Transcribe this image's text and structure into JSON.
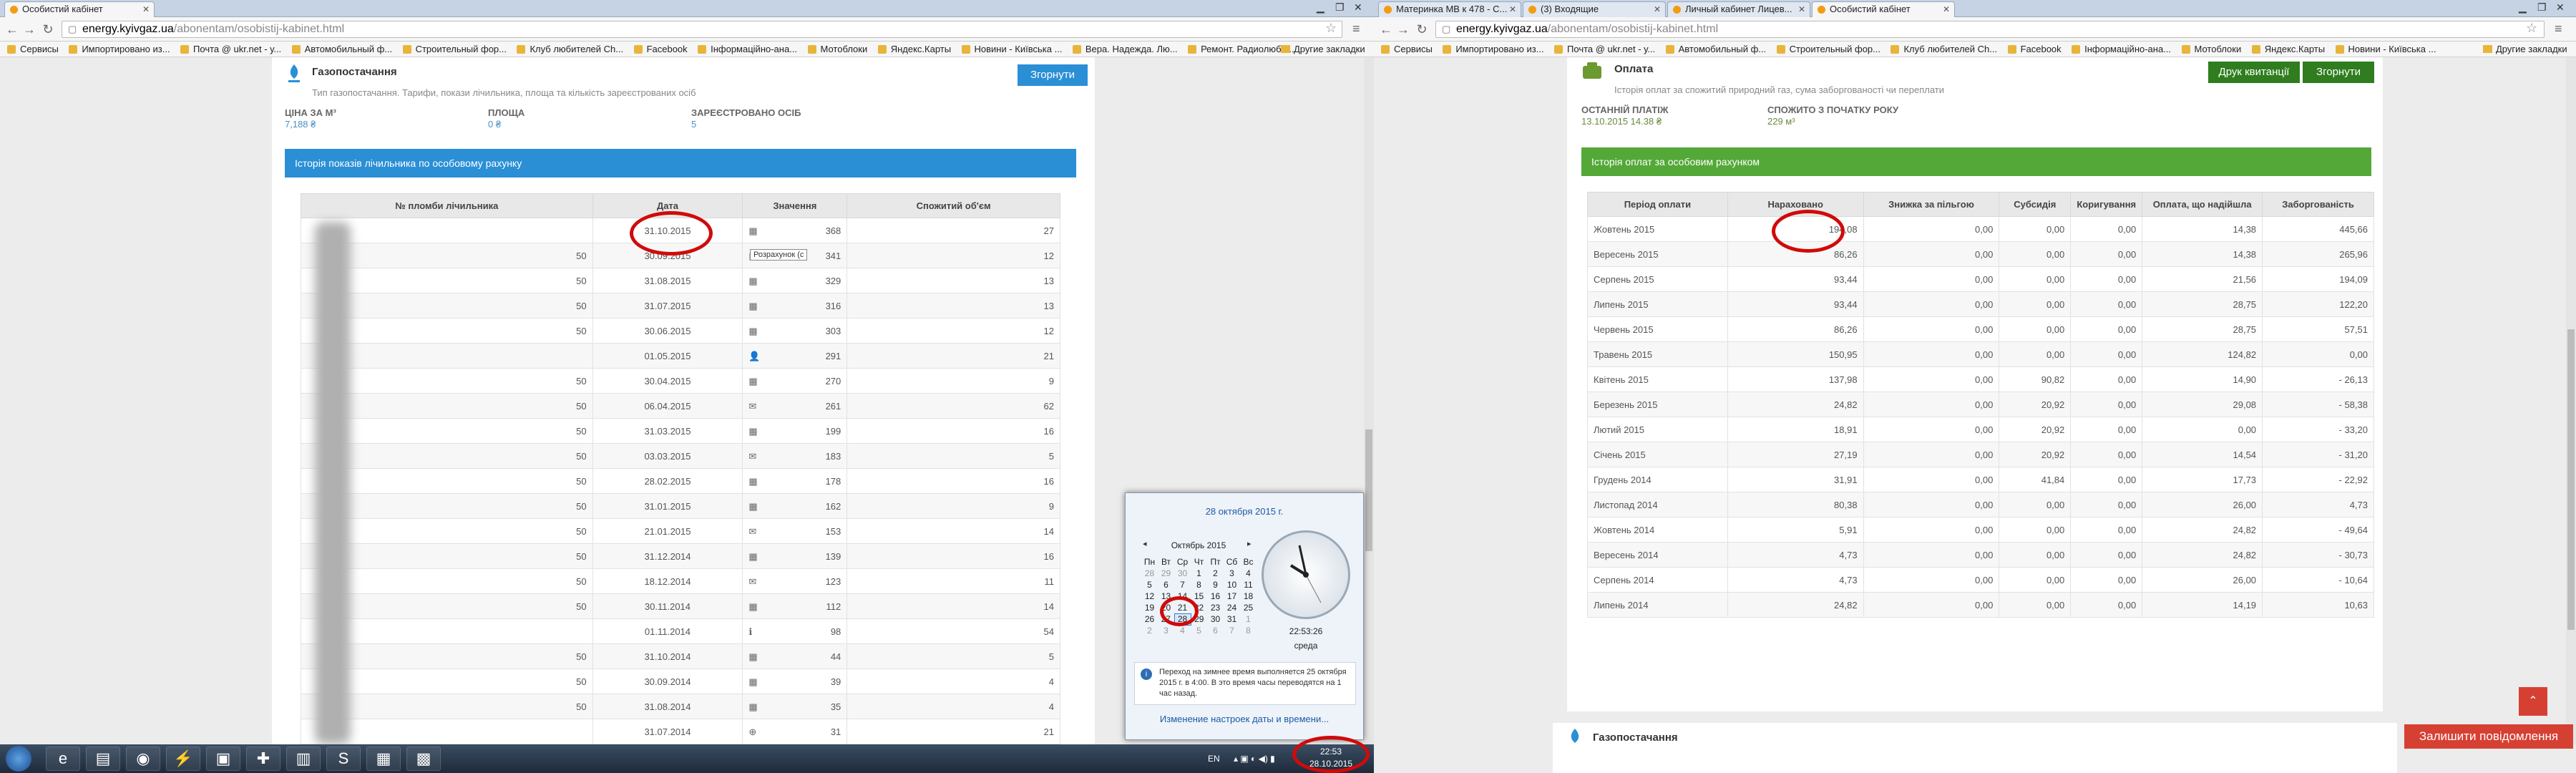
{
  "left": {
    "tabs": [
      {
        "title": "Особистий кабінет"
      }
    ],
    "url_host": "energy.kyivgaz.ua",
    "url_path": "/abonentam/osobistij-kabinet.html",
    "bookmarks": [
      "Сервисы",
      "Импортировано из...",
      "Почта @ ukr.net - у...",
      "Автомобильный ф...",
      "Строительный фор...",
      "Клуб любителей Ch...",
      "Facebook",
      "Інформаційно-ана...",
      "Мотоблоки",
      "Яндекс.Карты",
      "Новини - Київська ...",
      "Вера. Надежда. Лю...",
      "Ремонт. Радиолюби..."
    ],
    "bookmarks_other": "Другие закладки",
    "section": {
      "title": "Газопостачання",
      "subtitle": "Тип газопостачання. Тарифи, покази лічильника, площа та кількість зареєстрованих осіб",
      "collapse_label": "Згорнути"
    },
    "stats": [
      {
        "label": "ЦІНА ЗА М³",
        "value": "7,188 ₴"
      },
      {
        "label": "ПЛОЩА",
        "value": "0 ₴"
      },
      {
        "label": "ЗАРЕЄСТРОВАНО ОСІБ",
        "value": "5"
      }
    ],
    "history_title": "Історія показів лічильника по особовому рахунку",
    "headers": [
      "№ пломби лічильника",
      "Дата",
      "Значення",
      "Спожитий об'єм"
    ],
    "rows": [
      {
        "seal": "",
        "date": "31.10.2015",
        "icon": "▦",
        "value": "368",
        "volume": "27"
      },
      {
        "seal": "50",
        "date": "30.09.2015",
        "icon": "▦",
        "value": "341",
        "volume": "12"
      },
      {
        "seal": "50",
        "date": "31.08.2015",
        "icon": "▦",
        "value": "329",
        "volume": "13"
      },
      {
        "seal": "50",
        "date": "31.07.2015",
        "icon": "▦",
        "value": "316",
        "volume": "13"
      },
      {
        "seal": "50",
        "date": "30.06.2015",
        "icon": "▦",
        "value": "303",
        "volume": "12"
      },
      {
        "seal": "",
        "date": "01.05.2015",
        "icon": "👤",
        "value": "291",
        "volume": "21"
      },
      {
        "seal": "50",
        "date": "30.04.2015",
        "icon": "▦",
        "value": "270",
        "volume": "9"
      },
      {
        "seal": "50",
        "date": "06.04.2015",
        "icon": "✉",
        "value": "261",
        "volume": "62"
      },
      {
        "seal": "50",
        "date": "31.03.2015",
        "icon": "▦",
        "value": "199",
        "volume": "16"
      },
      {
        "seal": "50",
        "date": "03.03.2015",
        "icon": "✉",
        "value": "183",
        "volume": "5"
      },
      {
        "seal": "50",
        "date": "28.02.2015",
        "icon": "▦",
        "value": "178",
        "volume": "16"
      },
      {
        "seal": "50",
        "date": "31.01.2015",
        "icon": "▦",
        "value": "162",
        "volume": "9"
      },
      {
        "seal": "50",
        "date": "21.01.2015",
        "icon": "✉",
        "value": "153",
        "volume": "14"
      },
      {
        "seal": "50",
        "date": "31.12.2014",
        "icon": "▦",
        "value": "139",
        "volume": "16"
      },
      {
        "seal": "50",
        "date": "18.12.2014",
        "icon": "✉",
        "value": "123",
        "volume": "11"
      },
      {
        "seal": "50",
        "date": "30.11.2014",
        "icon": "▦",
        "value": "112",
        "volume": "14"
      },
      {
        "seal": "",
        "date": "01.11.2014",
        "icon": "ℹ",
        "value": "98",
        "volume": "54"
      },
      {
        "seal": "50",
        "date": "31.10.2014",
        "icon": "▦",
        "value": "44",
        "volume": "5"
      },
      {
        "seal": "50",
        "date": "30.09.2014",
        "icon": "▦",
        "value": "39",
        "volume": "4"
      },
      {
        "seal": "50",
        "date": "31.08.2014",
        "icon": "▦",
        "value": "35",
        "volume": "4"
      },
      {
        "seal": "",
        "date": "31.07.2014",
        "icon": "⊕",
        "value": "31",
        "volume": "21"
      }
    ],
    "tooltip": "Розрахунок (с",
    "calendar": {
      "header": "28 октября 2015 г.",
      "month": "Октябрь 2015",
      "weekdays": [
        "Пн",
        "Вт",
        "Ср",
        "Чт",
        "Пт",
        "Сб",
        "Вс"
      ],
      "weeks": [
        [
          "28",
          "29",
          "30",
          "1",
          "2",
          "3",
          "4"
        ],
        [
          "5",
          "6",
          "7",
          "8",
          "9",
          "10",
          "11"
        ],
        [
          "12",
          "13",
          "14",
          "15",
          "16",
          "17",
          "18"
        ],
        [
          "19",
          "20",
          "21",
          "22",
          "23",
          "24",
          "25"
        ],
        [
          "26",
          "27",
          "28",
          "29",
          "30",
          "31",
          "1"
        ],
        [
          "2",
          "3",
          "4",
          "5",
          "6",
          "7",
          "8"
        ]
      ],
      "time": "22:53:26",
      "day": "среда",
      "note": "Переход на зимнее время выполняется 25 октября 2015 г. в 4:00. В это время часы переводятся на 1 час назад.",
      "link": "Изменение настроек даты и времени..."
    },
    "taskbar": {
      "lang": "EN",
      "time": "22:53",
      "date": "28.10.2015"
    }
  },
  "right": {
    "tabs": [
      {
        "title": "Материнка MB к 478 - С..."
      },
      {
        "title": "(3) Входящие"
      },
      {
        "title": "Личный кабинет Лицев..."
      },
      {
        "title": "Особистий кабінет"
      }
    ],
    "url_host": "energy.kyivgaz.ua",
    "url_path": "/abonentam/osobistij-kabinet.html",
    "bookmarks": [
      "Сервисы",
      "Импортировано из...",
      "Почта @ ukr.net - у...",
      "Автомобильный ф...",
      "Строительный фор...",
      "Клуб любителей Ch...",
      "Facebook",
      "Інформаційно-ана...",
      "Мотоблоки",
      "Яндекс.Карты",
      "Новини - Київська ..."
    ],
    "bookmarks_other": "Другие закладки",
    "section": {
      "title": "Оплата",
      "subtitle": "Історія оплат за спожитий природний газ, сума заборгованості чи переплати",
      "print_label": "Друк квитанції",
      "collapse_label": "Згорнути"
    },
    "stats": [
      {
        "label": "ОСТАННІЙ ПЛАТІЖ",
        "value": "13.10.2015  14.38 ₴"
      },
      {
        "label": "СПОЖИТО З ПОЧАТКУ РОКУ",
        "value": "229 м³"
      }
    ],
    "history_title": "Історія оплат за особовим рахунком",
    "headers": [
      "Період оплати",
      "Нараховано",
      "Знижка за пільгою",
      "Субсидія",
      "Коригування",
      "Оплата, що надійшла",
      "Заборгованість"
    ],
    "rows": [
      [
        "Жовтень 2015",
        "194,08",
        "0,00",
        "0,00",
        "0,00",
        "14,38",
        "445,66"
      ],
      [
        "Вересень 2015",
        "86,26",
        "0,00",
        "0,00",
        "0,00",
        "14,38",
        "265,96"
      ],
      [
        "Серпень 2015",
        "93,44",
        "0,00",
        "0,00",
        "0,00",
        "21,56",
        "194,09"
      ],
      [
        "Липень 2015",
        "93,44",
        "0,00",
        "0,00",
        "0,00",
        "28,75",
        "122,20"
      ],
      [
        "Червень 2015",
        "86,26",
        "0,00",
        "0,00",
        "0,00",
        "28,75",
        "57,51"
      ],
      [
        "Травень 2015",
        "150,95",
        "0,00",
        "0,00",
        "0,00",
        "124,82",
        "0,00"
      ],
      [
        "Квітень 2015",
        "137,98",
        "0,00",
        "90,82",
        "0,00",
        "14,90",
        "- 26,13"
      ],
      [
        "Березень 2015",
        "24,82",
        "0,00",
        "20,92",
        "0,00",
        "29,08",
        "- 58,38"
      ],
      [
        "Лютий 2015",
        "18,91",
        "0,00",
        "20,92",
        "0,00",
        "0,00",
        "- 33,20"
      ],
      [
        "Січень 2015",
        "27,19",
        "0,00",
        "20,92",
        "0,00",
        "14,54",
        "- 31,20"
      ],
      [
        "Грудень 2014",
        "31,91",
        "0,00",
        "41,84",
        "0,00",
        "17,73",
        "- 22,92"
      ],
      [
        "Листопад 2014",
        "80,38",
        "0,00",
        "0,00",
        "0,00",
        "26,00",
        "4,73"
      ],
      [
        "Жовтень 2014",
        "5,91",
        "0,00",
        "0,00",
        "0,00",
        "24,82",
        "- 49,64"
      ],
      [
        "Вересень 2014",
        "4,73",
        "0,00",
        "0,00",
        "0,00",
        "24,82",
        "- 30,73"
      ],
      [
        "Серпень 2014",
        "4,73",
        "0,00",
        "0,00",
        "0,00",
        "26,00",
        "- 10,64"
      ],
      [
        "Липень 2014",
        "24,82",
        "0,00",
        "0,00",
        "0,00",
        "14,19",
        "10,63"
      ]
    ],
    "next_section": "Газопостачання",
    "feedback_label": "Залишити повідомлення"
  }
}
